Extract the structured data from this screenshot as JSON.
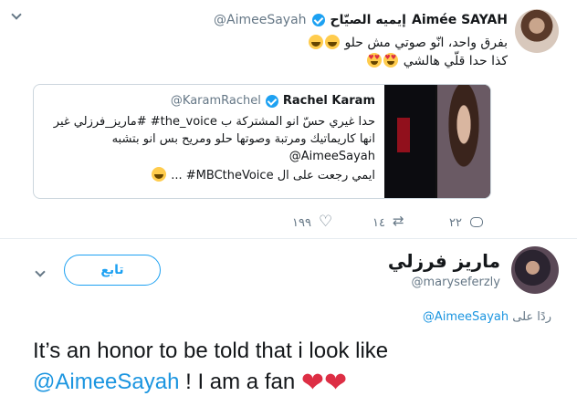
{
  "top_tweet": {
    "display_name_ar": "إيميه الصيّاح",
    "display_name_en": "Aimée SAYAH",
    "handle": "@AimeeSayah",
    "text_line1": "بفرق واحد، انّو صوتي مش حلو",
    "text_line2": "كذا حدا قلّي هالشي"
  },
  "quote": {
    "display_name": "Rachel Karam",
    "handle": "@KaramRachel",
    "line1": "حدا غيري حسّ انو المشتركة ب the_voice# #ماريز_فرزلي غير",
    "line2": "انها كاريماتيك ومرتبة وصوتها حلو ومريح بس انو بتشبه",
    "line3": "@AimeeSayah",
    "line4": "ايمي رجعت على ال MBCtheVoice# ..."
  },
  "actions": {
    "reply_count": "٢٢",
    "retweet_count": "١٤",
    "like_count": "١٩٩"
  },
  "reply_author": {
    "display_name": "ماريز فرزلي",
    "handle": "@maryseferzly",
    "follow_label": "تابع"
  },
  "replying_to": {
    "prefix": "ردًا على",
    "mention": "@AimeeSayah"
  },
  "reply_text": {
    "part1": "It’s an honor to be told that i look like",
    "mention": "@AimeeSayah",
    "part2": " ! I am a fan "
  },
  "colors": {
    "link": "#1b95e0",
    "verified": "#1da1f2",
    "muted": "#657786",
    "heart": "#dd2e44"
  }
}
